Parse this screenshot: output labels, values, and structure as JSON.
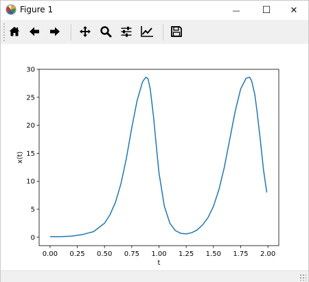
{
  "window": {
    "title": "Figure 1",
    "minimize_glyph": "—",
    "maximize_glyph": "☐",
    "close_glyph": "✕"
  },
  "toolbar": {
    "buttons": [
      {
        "name": "home-button",
        "icon": "home-icon"
      },
      {
        "name": "back-button",
        "icon": "arrow-left-icon"
      },
      {
        "name": "forward-button",
        "icon": "arrow-right-icon"
      },
      {
        "name": "pan-button",
        "icon": "move-arrows-icon"
      },
      {
        "name": "zoom-button",
        "icon": "magnifier-icon"
      },
      {
        "name": "configure-subplots-button",
        "icon": "sliders-icon"
      },
      {
        "name": "edit-axis-button",
        "icon": "line-chart-icon"
      },
      {
        "name": "save-button",
        "icon": "floppy-disk-icon"
      }
    ]
  },
  "colors": {
    "line": "#1f77b4",
    "toolbar_bg": "#f0f0f0",
    "axes": "#000000"
  },
  "chart_data": {
    "type": "line",
    "title": "",
    "xlabel": "t",
    "ylabel": "x(t)",
    "xlim": [
      -0.1,
      2.1
    ],
    "ylim": [
      -1.5,
      30
    ],
    "xticks": [
      0.0,
      0.25,
      0.5,
      0.75,
      1.0,
      1.25,
      1.5,
      1.75,
      2.0
    ],
    "xtick_labels": [
      "0.00",
      "0.25",
      "0.50",
      "0.75",
      "1.00",
      "1.25",
      "1.50",
      "1.75",
      "2.00"
    ],
    "yticks": [
      0,
      5,
      10,
      15,
      20,
      25,
      30
    ],
    "ytick_labels": [
      "0",
      "5",
      "10",
      "15",
      "20",
      "25",
      "30"
    ],
    "grid": false,
    "series": [
      {
        "x": [
          0.0,
          0.1,
          0.2,
          0.3,
          0.4,
          0.5,
          0.55,
          0.6,
          0.65,
          0.7,
          0.75,
          0.8,
          0.85,
          0.88,
          0.9,
          0.92,
          0.95,
          0.98,
          1.0,
          1.05,
          1.1,
          1.15,
          1.2,
          1.25,
          1.3,
          1.35,
          1.4,
          1.45,
          1.5,
          1.55,
          1.6,
          1.65,
          1.7,
          1.75,
          1.8,
          1.83,
          1.85,
          1.88,
          1.9,
          1.93,
          1.96,
          1.99
        ],
        "y": [
          0.1,
          0.1,
          0.2,
          0.5,
          1.0,
          2.5,
          4.0,
          6.2,
          9.5,
          14.0,
          19.5,
          24.5,
          27.8,
          28.6,
          28.3,
          26.5,
          21.5,
          15.5,
          11.5,
          5.5,
          2.5,
          1.2,
          0.7,
          0.6,
          0.8,
          1.3,
          2.2,
          3.5,
          5.5,
          8.5,
          12.5,
          17.5,
          22.5,
          26.5,
          28.4,
          28.6,
          28.0,
          25.5,
          22.5,
          17.5,
          12.0,
          8.0
        ]
      }
    ]
  }
}
